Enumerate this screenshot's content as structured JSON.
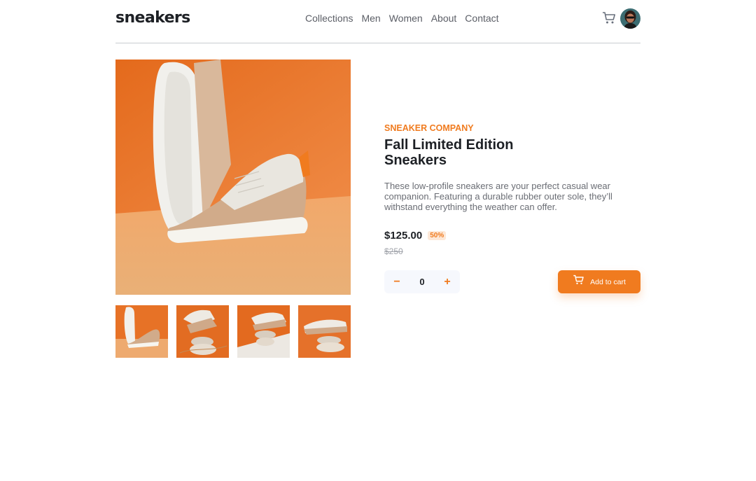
{
  "header": {
    "logo": "sneakers",
    "nav": [
      "Collections",
      "Men",
      "Women",
      "About",
      "Contact"
    ],
    "cart_icon": "cart-icon",
    "avatar": "user-avatar"
  },
  "gallery": {
    "main_alt": "Fall Limited Edition Sneakers product image",
    "thumbnails": 4
  },
  "product": {
    "company": "Sneaker Company",
    "title": "Fall Limited Edition Sneakers",
    "description": "These low-profile sneakers are your perfect casual wear companion. Featuring a durable rubber outer sole, they’ll withstand everything the weather can offer.",
    "price": "$125.00",
    "discount": "50%",
    "old_price": "$250",
    "quantity": "0",
    "decrement": "−",
    "increment": "+",
    "add_to_cart": "Add to cart"
  },
  "colors": {
    "accent": "#f07b1f",
    "accent_light": "#fde8d7",
    "dark": "#1d2025",
    "muted": "#6a6d74"
  }
}
